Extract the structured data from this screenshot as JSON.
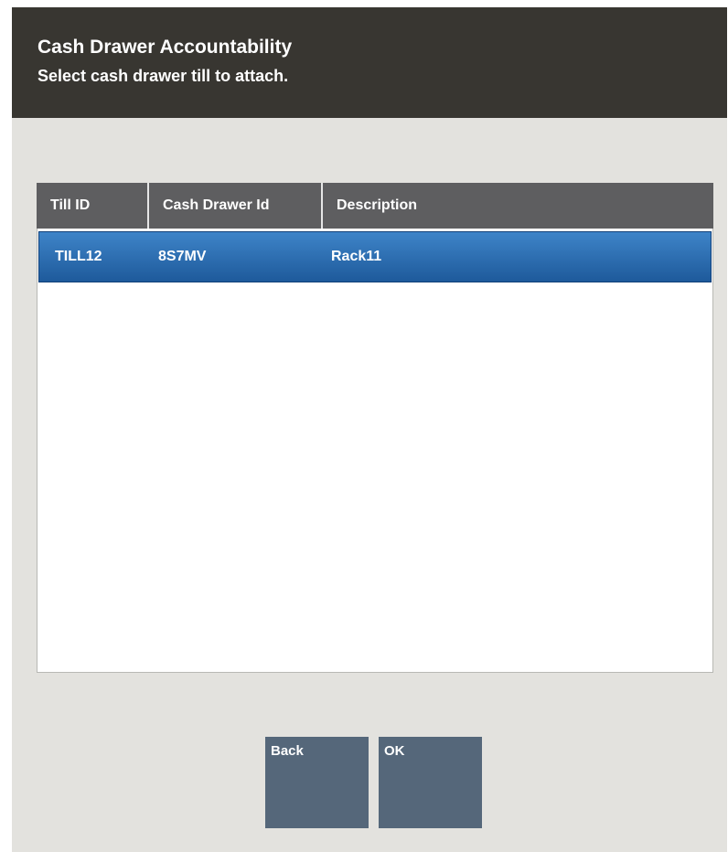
{
  "header": {
    "title": "Cash Drawer Accountability",
    "subtitle": "Select cash drawer till to attach."
  },
  "table": {
    "columns": [
      "Till ID",
      "Cash Drawer Id",
      "Description"
    ],
    "rows": [
      {
        "till_id": "TILL12",
        "cash_drawer_id": "8S7MV",
        "description": "Rack11",
        "selected": true
      }
    ]
  },
  "buttons": {
    "back_label": "Back",
    "ok_label": "OK"
  },
  "colors": {
    "header_bg": "#383631",
    "dialog_bg": "#e3e2de",
    "table_header_bg": "#5e5e60",
    "selected_row": "#2a6aad",
    "button_bg": "#55677a"
  }
}
